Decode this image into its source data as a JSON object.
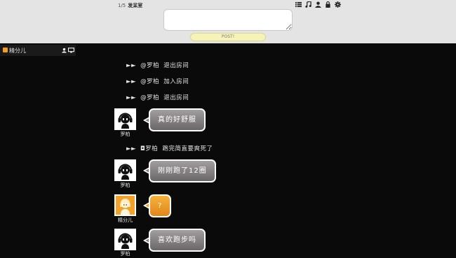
{
  "header": {
    "room_count": "1/5",
    "room_name": "发呆室",
    "post_label": "POST!",
    "input_value": "",
    "toolbar_icons": [
      "list-icon",
      "music-icon",
      "user-icon",
      "lock-icon",
      "gear-icon"
    ]
  },
  "userbar": {
    "username": "精分儿",
    "status_color": "#f0a020",
    "icons": [
      "user-icon",
      "monitor-icon"
    ]
  },
  "chat": {
    "arrows": "►►",
    "sys1": "@罗柏 退出房间",
    "sys2": "@罗柏 加入房间",
    "sys3": "@罗柏 退出房间",
    "msg1": {
      "user": "罗柏",
      "text": "真的好舒服"
    },
    "sys4": "◘罗柏 跑完简直要爽死了",
    "msg2": {
      "user": "罗柏",
      "text": "刚刚跑了12圈"
    },
    "msg3": {
      "user": "精分儿",
      "text": "?"
    },
    "msg4": {
      "user": "罗柏",
      "text": "喜欢跑步吗"
    },
    "colors": {
      "grey_bubble": "#8a8586",
      "orange_bubble": "#eea02a",
      "background": "#0a0a0a"
    }
  }
}
